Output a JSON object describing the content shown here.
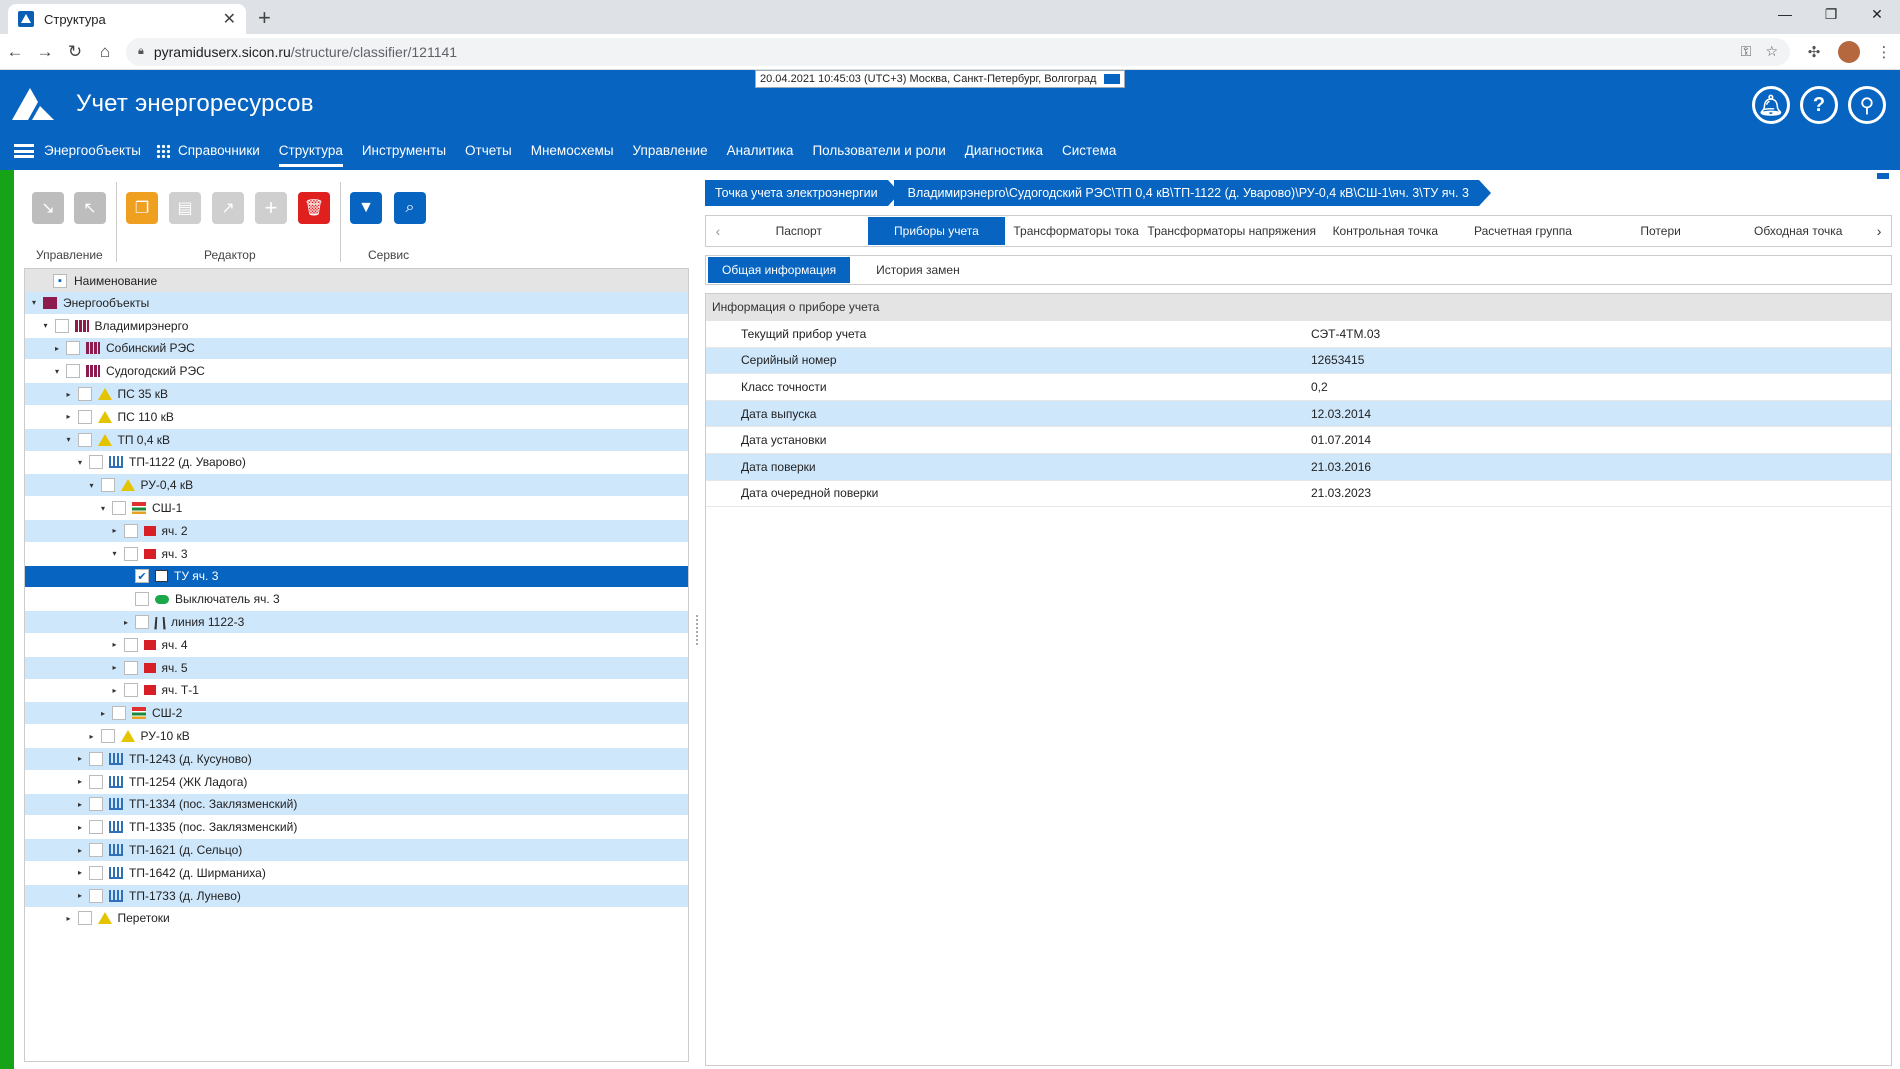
{
  "browser": {
    "tab_title": "Структура",
    "url_host": "pyramiduserx.sicon.ru",
    "url_path": "/structure/classifier/121141"
  },
  "header": {
    "datetime": "20.04.2021 10:45:03 (UTC+3) Москва, Санкт-Петербург, Волгоград",
    "title": "Учет энергоресурсов",
    "menu": [
      "Энергообъекты",
      "Справочники",
      "Структура",
      "Инструменты",
      "Отчеты",
      "Мнемосхемы",
      "Управление",
      "Аналитика",
      "Пользователи и роли",
      "Диагностика",
      "Система"
    ],
    "active_menu": "Структура"
  },
  "toolbar": {
    "group_manage": "Управление",
    "group_editor": "Редактор",
    "group_service": "Сервис"
  },
  "tree": {
    "header": "Наименование",
    "rows": [
      {
        "label": "Энергообъекты",
        "level": 0,
        "toggle": "▾",
        "icon": "region",
        "checkbox": false
      },
      {
        "label": "Владимирэнерго",
        "level": 1,
        "toggle": "▾",
        "icon": "res",
        "checkbox": true
      },
      {
        "label": "Собинский РЭС",
        "level": 2,
        "toggle": "▸",
        "icon": "res",
        "checkbox": true
      },
      {
        "label": "Судогодский РЭС",
        "level": 2,
        "toggle": "▾",
        "icon": "res",
        "checkbox": true
      },
      {
        "label": "ПС 35 кВ",
        "level": 3,
        "toggle": "▸",
        "icon": "warn",
        "checkbox": true
      },
      {
        "label": "ПС 110 кВ",
        "level": 3,
        "toggle": "▸",
        "icon": "warn",
        "checkbox": true
      },
      {
        "label": "ТП 0,4 кВ",
        "level": 3,
        "toggle": "▾",
        "icon": "warn",
        "checkbox": true
      },
      {
        "label": "ТП-1122 (д. Уварово)",
        "level": 4,
        "toggle": "▾",
        "icon": "tp",
        "checkbox": true
      },
      {
        "label": "РУ-0,4 кВ",
        "level": 5,
        "toggle": "▾",
        "icon": "warn",
        "checkbox": true
      },
      {
        "label": "СШ-1",
        "level": 6,
        "toggle": "▾",
        "icon": "bus",
        "checkbox": true
      },
      {
        "label": "яч. 2",
        "level": 7,
        "toggle": "▸",
        "icon": "cell",
        "checkbox": true
      },
      {
        "label": "яч. 3",
        "level": 7,
        "toggle": "▾",
        "icon": "cell",
        "checkbox": true
      },
      {
        "label": "ТУ яч. 3",
        "level": 8,
        "toggle": "",
        "icon": "tu",
        "checkbox": true,
        "checked": true,
        "selected": true
      },
      {
        "label": "Выключатель яч. 3",
        "level": 8,
        "toggle": "",
        "icon": "sw",
        "checkbox": true
      },
      {
        "label": "линия 1122-3",
        "level": 8,
        "toggle": "▸",
        "icon": "line",
        "checkbox": true
      },
      {
        "label": "яч. 4",
        "level": 7,
        "toggle": "▸",
        "icon": "cell",
        "checkbox": true
      },
      {
        "label": "яч. 5",
        "level": 7,
        "toggle": "▸",
        "icon": "cell",
        "checkbox": true
      },
      {
        "label": "яч. Т-1",
        "level": 7,
        "toggle": "▸",
        "icon": "cell",
        "checkbox": true
      },
      {
        "label": "СШ-2",
        "level": 6,
        "toggle": "▸",
        "icon": "bus",
        "checkbox": true
      },
      {
        "label": "РУ-10 кВ",
        "level": 5,
        "toggle": "▸",
        "icon": "warn",
        "checkbox": true
      },
      {
        "label": "ТП-1243 (д. Кусуново)",
        "level": 4,
        "toggle": "▸",
        "icon": "tp",
        "checkbox": true
      },
      {
        "label": "ТП-1254 (ЖК Ладога)",
        "level": 4,
        "toggle": "▸",
        "icon": "tp",
        "checkbox": true
      },
      {
        "label": "ТП-1334 (пос. Заклязменский)",
        "level": 4,
        "toggle": "▸",
        "icon": "tp",
        "checkbox": true
      },
      {
        "label": "ТП-1335 (пос. Заклязменский)",
        "level": 4,
        "toggle": "▸",
        "icon": "tp",
        "checkbox": true
      },
      {
        "label": "ТП-1621 (д. Сельцо)",
        "level": 4,
        "toggle": "▸",
        "icon": "tp",
        "checkbox": true
      },
      {
        "label": "ТП-1642 (д. Ширманиха)",
        "level": 4,
        "toggle": "▸",
        "icon": "tp",
        "checkbox": true
      },
      {
        "label": "ТП-1733 (д. Лунево)",
        "level": 4,
        "toggle": "▸",
        "icon": "tp",
        "checkbox": true
      },
      {
        "label": "Перетоки",
        "level": 3,
        "toggle": "▸",
        "icon": "warn",
        "checkbox": true
      }
    ]
  },
  "breadcrumb": [
    "Точка учета электроэнергии",
    "Владимирэнерго\\Судогодский РЭС\\ТП 0,4 кВ\\ТП-1122 (д. Уварово)\\РУ-0,4 кВ\\СШ-1\\яч. 3\\ТУ яч. 3"
  ],
  "tabs": [
    "Паспорт",
    "Приборы учета",
    "Трансформаторы тока",
    "Трансформаторы напряжения",
    "Контрольная точка",
    "Расчетная группа",
    "Потери",
    "Обходная точка"
  ],
  "active_tab": "Приборы учета",
  "subtabs": [
    "Общая информация",
    "История замен"
  ],
  "active_subtab": "Общая информация",
  "info": {
    "title": "Информация о приборе учета",
    "rows": [
      {
        "k": "Текущий прибор учета",
        "v": "СЭТ-4ТМ.03"
      },
      {
        "k": "Серийный номер",
        "v": "12653415"
      },
      {
        "k": "Класс точности",
        "v": "0,2"
      },
      {
        "k": "Дата выпуска",
        "v": "12.03.2014"
      },
      {
        "k": "Дата установки",
        "v": "01.07.2014"
      },
      {
        "k": "Дата поверки",
        "v": "21.03.2016"
      },
      {
        "k": "Дата очередной поверки",
        "v": "21.03.2023"
      }
    ]
  },
  "colors": {
    "brand": "#0764c0",
    "row_alt": "#cfe7fb",
    "green_bar": "#17a317",
    "delete": "#e01f1f",
    "copy": "#f0a020"
  }
}
